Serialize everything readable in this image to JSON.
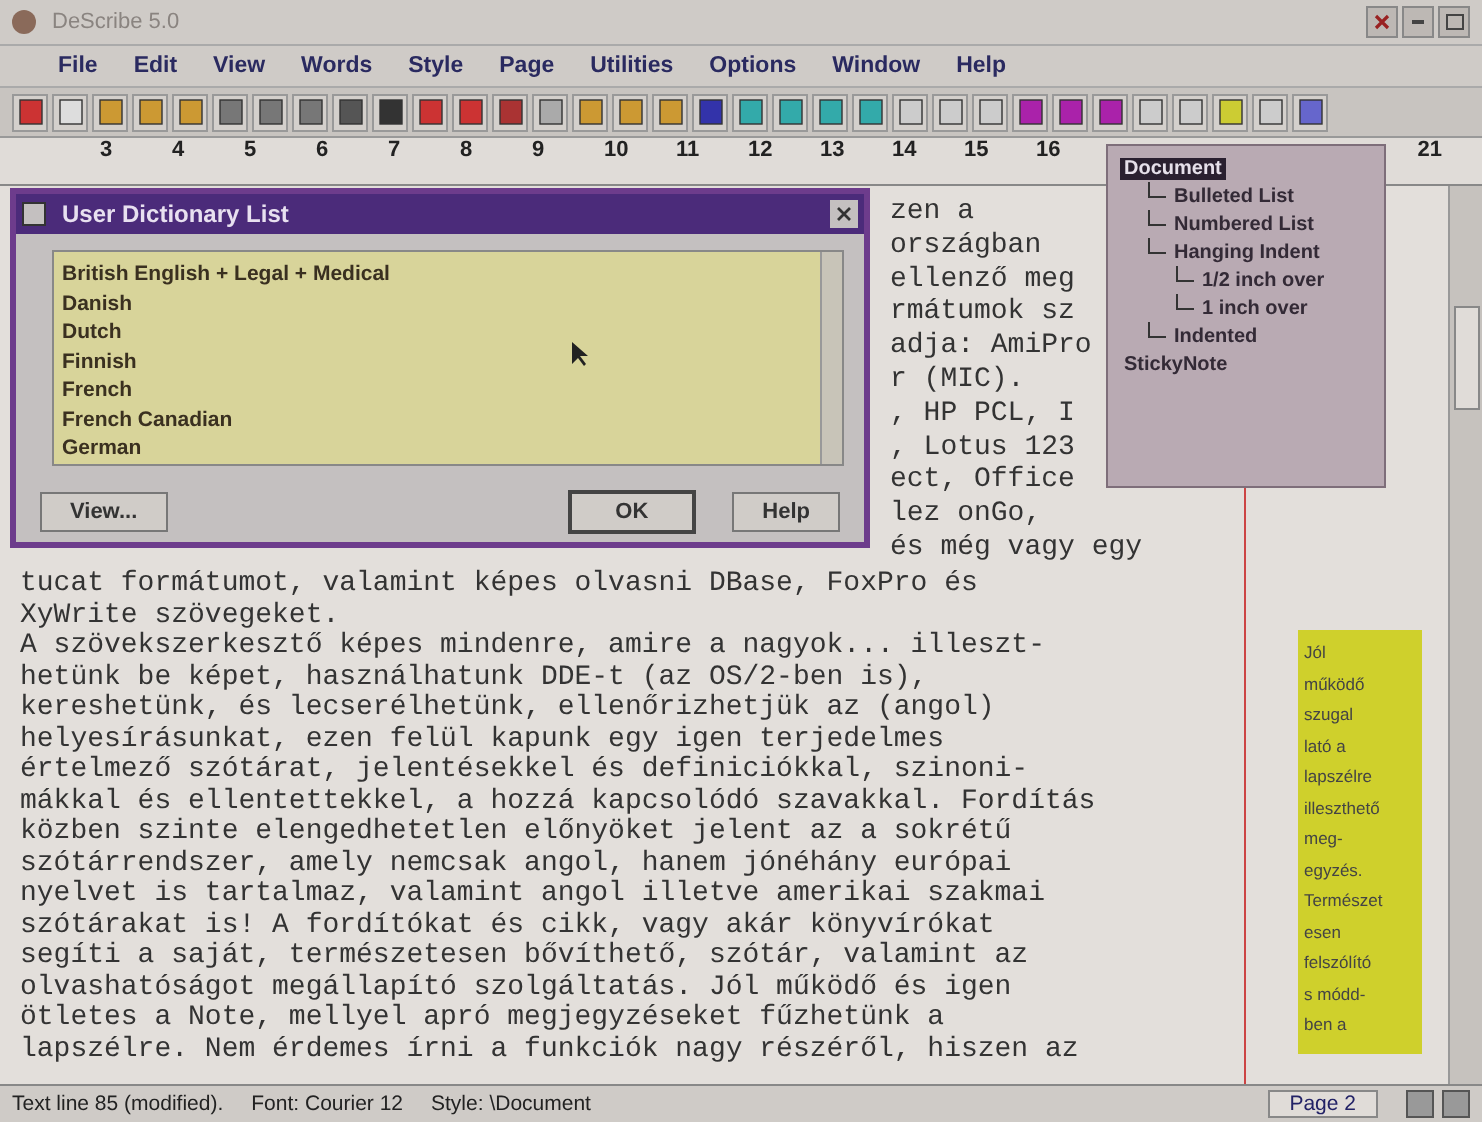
{
  "window": {
    "title": "DeScribe 5.0"
  },
  "menu": [
    "File",
    "Edit",
    "View",
    "Words",
    "Style",
    "Page",
    "Utilities",
    "Options",
    "Window",
    "Help"
  ],
  "ruler": {
    "marks": [
      "3",
      "4",
      "5",
      "6",
      "7",
      "8",
      "9",
      "10",
      "11",
      "12",
      "13",
      "14",
      "15",
      "16"
    ],
    "end_mark": "21"
  },
  "document": {
    "covered_lines": [
      "zen a",
      "országban",
      "ellenző meg",
      "rmátumok sz",
      "adja: AmiPro",
      "r (MIC).",
      ", HP PCL, I",
      ", Lotus 123",
      "ect, Office",
      "lez onGo,",
      "és még vagy egy"
    ],
    "lines": [
      "tucat formátumot, valamint képes olvasni DBase, FoxPro és",
      "XyWrite szövegeket.",
      "A szövekszerkesztő képes mindenre, amire a nagyok... illeszt-",
      "hetünk be képet, használhatunk DDE-t (az OS/2-ben is),",
      "kereshetünk, és lecserélhetünk, ellenőrizhetjük az (angol)",
      "helyesírásunkat, ezen felül kapunk egy igen terjedelmes",
      "értelmező szótárat, jelentésekkel és definiciókkal, szinoni-",
      "mákkal és ellentettekkel, a hozzá kapcsolódó szavakkal. Fordítás",
      "közben szinte elengedhetetlen előnyöket jelent az a sokrétű",
      "szótárrendszer, amely nemcsak angol, hanem jónéhány európai",
      "nyelvet is tartalmaz, valamint angol illetve amerikai szakmai",
      "szótárakat is! A fordítókat és cikk, vagy akár könyvírókat",
      "segíti a saját, természetesen bővíthető, szótár, valamint az",
      "olvashatóságot megállapító szolgáltatás. Jól működő és igen",
      "ötletes a Note, mellyel apró megjegyzéseket fűzhetünk a",
      "lapszélre. Nem érdemes írni a funkciók nagy részéről, hiszen az"
    ]
  },
  "sticky_note": {
    "lines": [
      "Jól",
      "működő",
      "szugal",
      "lató a",
      "lapszélre",
      "illeszthető",
      "meg-",
      "egyzés.",
      "Természet",
      "esen",
      "felszólító",
      "s módd-",
      "ben a"
    ]
  },
  "dialog": {
    "title": "User Dictionary List",
    "items": [
      "British English + Legal + Medical",
      "Danish",
      "Dutch",
      "Finnish",
      "French",
      "French Canadian",
      "German"
    ],
    "buttons": [
      {
        "label": "View...",
        "kind": "left"
      },
      {
        "label": "OK",
        "kind": "default"
      },
      {
        "label": "Help",
        "kind": "right"
      }
    ]
  },
  "style_tree": [
    {
      "label": "Document",
      "selected": true,
      "children": [
        {
          "label": "Bulleted List",
          "selected": false
        },
        {
          "label": "Numbered List",
          "selected": false
        },
        {
          "label": "Hanging Indent",
          "selected": false,
          "children": [
            {
              "label": "1/2 inch over",
              "selected": false
            },
            {
              "label": "1 inch over",
              "selected": false
            }
          ]
        },
        {
          "label": "Indented",
          "selected": false
        }
      ]
    },
    {
      "label": "StickyNote",
      "selected": false
    }
  ],
  "status_bar": {
    "line": "Text line 85 (modified).",
    "font": "Font: Courier 12",
    "style": "Style: \\Document",
    "page": "Page 2"
  }
}
